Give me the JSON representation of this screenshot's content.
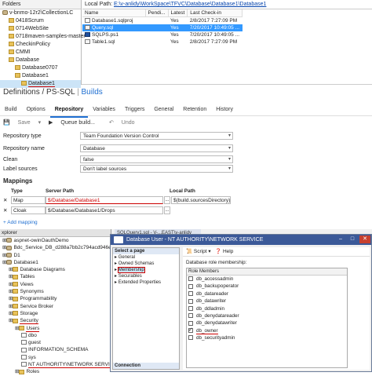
{
  "source_control": {
    "folders_header": "Folders",
    "tree": [
      {
        "label": "v-bnmo-12r2\\CollectionLC",
        "indent": 0,
        "icon": "server-icon"
      },
      {
        "label": "0418Scrum",
        "indent": 1,
        "icon": "folder-icon"
      },
      {
        "label": "0714WebSite",
        "indent": 1,
        "icon": "folder-icon"
      },
      {
        "label": "0718maven-samples-master",
        "indent": 1,
        "icon": "folder-icon"
      },
      {
        "label": "CheckinPolicy",
        "indent": 1,
        "icon": "folder-icon"
      },
      {
        "label": "CMMI",
        "indent": 1,
        "icon": "folder-icon"
      },
      {
        "label": "Database",
        "indent": 1,
        "icon": "folder-icon"
      },
      {
        "label": "Database0707",
        "indent": 2,
        "icon": "folder-icon"
      },
      {
        "label": "Database1",
        "indent": 2,
        "icon": "folder-icon"
      },
      {
        "label": "Database1",
        "indent": 3,
        "icon": "folder-icon",
        "selected": true
      }
    ],
    "local_path_label": "Local Path:",
    "local_path": "E:\\v-anlidy\\WorkSpace\\TFVC\\Database\\Database1\\Database1",
    "columns": [
      "Name",
      "Pendi...",
      "Latest",
      "Last Check-in"
    ],
    "files": [
      {
        "name": "Database1.sqlproj",
        "pending": "",
        "latest": "Yes",
        "checkin": "2/8/2017 7:27:09 PM",
        "icon": "file-icon"
      },
      {
        "name": "Query.sql",
        "pending": "",
        "latest": "Yes",
        "checkin": "7/20/2017 10:49:05 ...",
        "icon": "sql-file-icon",
        "selected": true
      },
      {
        "name": "SQLPS.ps1",
        "pending": "",
        "latest": "Yes",
        "checkin": "7/20/2017 10:49:05 ...",
        "icon": "powershell-icon"
      },
      {
        "name": "Table1.sql",
        "pending": "",
        "latest": "Yes",
        "checkin": "2/8/2017 7:27:09 PM",
        "icon": "sql-file-icon"
      }
    ]
  },
  "build": {
    "title_prefix": "Definitions / PS-SQL",
    "title_link": "Builds",
    "tabs": [
      "Build",
      "Options",
      "Repository",
      "Variables",
      "Triggers",
      "General",
      "Retention",
      "History"
    ],
    "active_tab": "Repository",
    "toolbar": {
      "save": "Save",
      "queue": "Queue build...",
      "undo": "Undo"
    },
    "fields": [
      {
        "label": "Repository type",
        "value": "Team Foundation Version Control"
      },
      {
        "label": "Repository name",
        "value": "Database"
      },
      {
        "label": "Clean",
        "value": "false"
      },
      {
        "label": "Label sources",
        "value": "Don't label sources"
      }
    ],
    "mappings_title": "Mappings",
    "mapping_headers": {
      "type": "Type",
      "server": "Server Path",
      "local": "Local Path"
    },
    "mappings": [
      {
        "type": "Map",
        "server": "$/Database/Database1",
        "local": "$(build.sourcesDirectory)\\"
      },
      {
        "type": "Cloak",
        "server": "$/Database/Database1/Drops",
        "local": ""
      }
    ],
    "add_mapping": "Add mapping"
  },
  "ssms": {
    "explorer_header": "xplorer",
    "doc_tab": "SQLQuery1.sql - V-...EAST\\v-anlidy (75))",
    "tree": [
      {
        "label": "aspnet-owinOauthDemo",
        "indent": 0,
        "icon": "database-icon"
      },
      {
        "label": "Bdc_Service_DB_d288a7bb2c794acd946ed2d9537",
        "indent": 0,
        "icon": "database-icon"
      },
      {
        "label": "D1",
        "indent": 0,
        "icon": "database-icon"
      },
      {
        "label": "Database1",
        "indent": 0,
        "icon": "database-icon"
      },
      {
        "label": "Database Diagrams",
        "indent": 1,
        "icon": "folder-icon"
      },
      {
        "label": "Tables",
        "indent": 1,
        "icon": "folder-icon"
      },
      {
        "label": "Views",
        "indent": 1,
        "icon": "folder-icon"
      },
      {
        "label": "Synonyms",
        "indent": 1,
        "icon": "folder-icon"
      },
      {
        "label": "Programmability",
        "indent": 1,
        "icon": "folder-icon"
      },
      {
        "label": "Service Broker",
        "indent": 1,
        "icon": "folder-icon"
      },
      {
        "label": "Storage",
        "indent": 1,
        "icon": "folder-icon"
      },
      {
        "label": "Security",
        "indent": 1,
        "icon": "folder-icon",
        "red": true
      },
      {
        "label": "Users",
        "indent": 2,
        "icon": "folder-icon",
        "red": true
      },
      {
        "label": "dbo",
        "indent": 3,
        "icon": "user-icon"
      },
      {
        "label": "guest",
        "indent": 3,
        "icon": "user-icon"
      },
      {
        "label": "INFORMATION_SCHEMA",
        "indent": 3,
        "icon": "user-icon"
      },
      {
        "label": "sys",
        "indent": 3,
        "icon": "user-icon"
      },
      {
        "label": "NT AUTHORITY\\NETWORK SERVICE",
        "indent": 3,
        "icon": "user-icon",
        "red": true
      },
      {
        "label": "Roles",
        "indent": 2,
        "icon": "folder-icon"
      }
    ],
    "dialog_title": "Database User - NT AUTHORITY\\NETWORK SERVICE",
    "select_page_header": "Select a page",
    "pages": [
      "General",
      "Owned Schemas",
      "Membership",
      "Securables",
      "Extended Properties"
    ],
    "selected_page": "Membership",
    "connection_header": "Connection",
    "toolbar": {
      "script": "Script",
      "help": "Help"
    },
    "membership_label": "Database role membership:",
    "role_members_header": "Role Members",
    "roles": [
      {
        "name": "db_accessadmin",
        "checked": false
      },
      {
        "name": "db_backupoperator",
        "checked": false
      },
      {
        "name": "db_datareader",
        "checked": false
      },
      {
        "name": "db_datawriter",
        "checked": false
      },
      {
        "name": "db_ddladmin",
        "checked": false
      },
      {
        "name": "db_denydatareader",
        "checked": false
      },
      {
        "name": "db_denydatawriter",
        "checked": false
      },
      {
        "name": "db_owner",
        "checked": true
      },
      {
        "name": "db_securityadmin",
        "checked": false
      }
    ]
  }
}
